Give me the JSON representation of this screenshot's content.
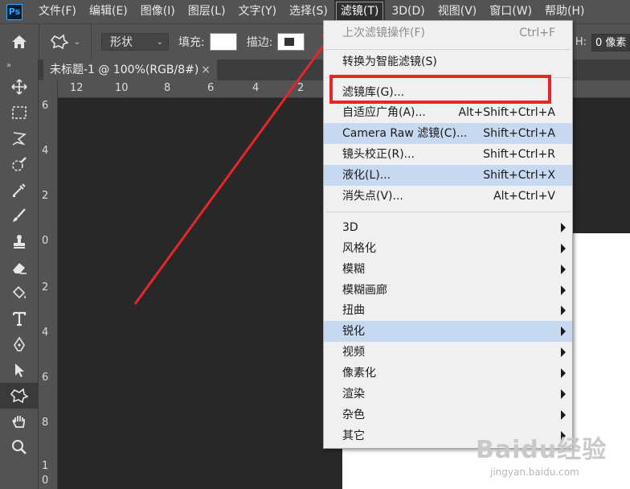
{
  "app": {
    "logo": "Ps"
  },
  "menubar": {
    "items": [
      {
        "label": "文件(F)"
      },
      {
        "label": "编辑(E)"
      },
      {
        "label": "图像(I)"
      },
      {
        "label": "图层(L)"
      },
      {
        "label": "文字(Y)"
      },
      {
        "label": "选择(S)"
      },
      {
        "label": "滤镜(T)",
        "active": true
      },
      {
        "label": "3D(D)"
      },
      {
        "label": "视图(V)"
      },
      {
        "label": "窗口(W)"
      },
      {
        "label": "帮助(H)"
      }
    ]
  },
  "options": {
    "shape_mode": "形状",
    "fill_label": "填充:",
    "stroke_label": "描边:",
    "h_label": "H:",
    "px_value": "0 像素"
  },
  "document": {
    "tab_title": "未标题-1 @ 100%(RGB/8#)",
    "tab_close": "×"
  },
  "rulers": {
    "top": [
      "12",
      "10",
      "8",
      "6",
      "4",
      "2"
    ],
    "left": [
      "6",
      "4",
      "2",
      "0",
      "2",
      "4",
      "6",
      "8",
      "1",
      "0"
    ]
  },
  "filter_menu": {
    "last_filter": {
      "label": "上次滤镜操作(F)",
      "shortcut": "Ctrl+F"
    },
    "smart": {
      "label": "转换为智能滤镜(S)"
    },
    "items": [
      {
        "label": "滤镜库(G)...",
        "shortcut": ""
      },
      {
        "label": "自适应广角(A)...",
        "shortcut": "Alt+Shift+Ctrl+A"
      },
      {
        "label": "Camera Raw 滤镜(C)...",
        "shortcut": "Shift+Ctrl+A"
      },
      {
        "label": "镜头校正(R)...",
        "shortcut": "Shift+Ctrl+R"
      },
      {
        "label": "液化(L)...",
        "shortcut": "Shift+Ctrl+X"
      },
      {
        "label": "消失点(V)...",
        "shortcut": "Alt+Ctrl+V"
      }
    ],
    "submenus": [
      {
        "label": "3D"
      },
      {
        "label": "风格化"
      },
      {
        "label": "模糊"
      },
      {
        "label": "模糊画廊"
      },
      {
        "label": "扭曲"
      },
      {
        "label": "锐化"
      },
      {
        "label": "视频"
      },
      {
        "label": "像素化"
      },
      {
        "label": "渲染"
      },
      {
        "label": "杂色"
      },
      {
        "label": "其它"
      }
    ]
  },
  "watermark": {
    "brand": "Baidu经验",
    "url": "jingyan.baidu.com"
  },
  "colors": {
    "annotation_red": "#e6262b",
    "highlight": "#c7d9f0"
  }
}
